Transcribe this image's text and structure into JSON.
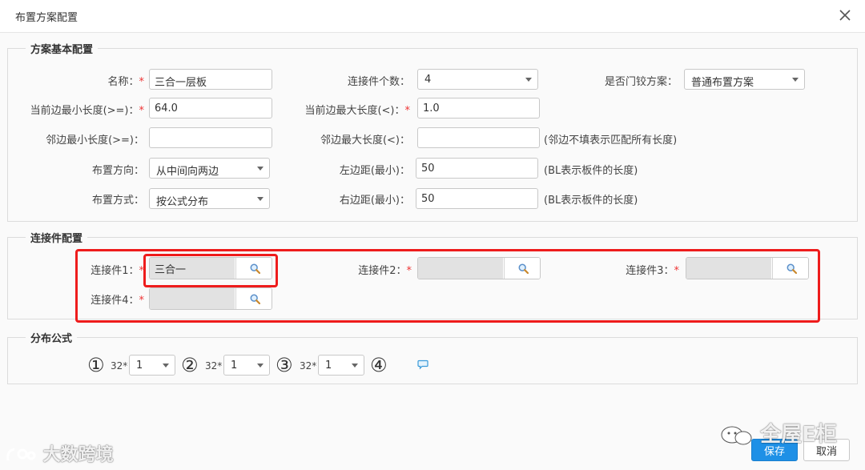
{
  "dialog": {
    "title": "布置方案配置"
  },
  "basic": {
    "legend": "方案基本配置",
    "name": {
      "label": "名称：",
      "value": "三合一层板"
    },
    "conn_count": {
      "label": "连接件个数：",
      "value": "4"
    },
    "hinge_scheme": {
      "label": "是否门铰方案：",
      "value": "普通布置方案"
    },
    "cur_min_len": {
      "label": "当前边最小长度(>=)：",
      "value": "64.0"
    },
    "cur_max_len": {
      "label": "当前边最大长度(<)：",
      "value": "1.0"
    },
    "adj_min_len": {
      "label": "邻边最小长度(>=)：",
      "value": ""
    },
    "adj_max_len": {
      "label": "邻边最大长度(<)：",
      "value": "",
      "hint": "(邻边不填表示匹配所有长度)"
    },
    "direction": {
      "label": "布置方向：",
      "value": "从中间向两边"
    },
    "left_margin": {
      "label": "左边距(最小)：",
      "value": "50",
      "hint": "(BL表示板件的长度)"
    },
    "mode": {
      "label": "布置方式：",
      "value": "按公式分布"
    },
    "right_margin": {
      "label": "右边距(最小)：",
      "value": "50",
      "hint": "(BL表示板件的长度)"
    }
  },
  "connectors": {
    "legend": "连接件配置",
    "items": [
      {
        "label": "连接件1：",
        "value": "三合一"
      },
      {
        "label": "连接件2：",
        "value": ""
      },
      {
        "label": "连接件3：",
        "value": ""
      },
      {
        "label": "连接件4：",
        "value": ""
      }
    ]
  },
  "formula": {
    "legend": "分布公式",
    "circles": [
      "①",
      "②",
      "③",
      "④"
    ],
    "multiplier": "32*",
    "selects": [
      "1",
      "1",
      "1"
    ]
  },
  "footer": {
    "save": "保存",
    "cancel": "取消"
  },
  "watermarks": {
    "left": "大数跨境",
    "right": "全屋E柜"
  },
  "colors": {
    "accent": "#1e90e6",
    "highlight": "#ee1c1c",
    "required": "#e33333"
  },
  "icons": [
    "close-icon",
    "chevron-down-icon",
    "search-icon",
    "chat-icon"
  ]
}
